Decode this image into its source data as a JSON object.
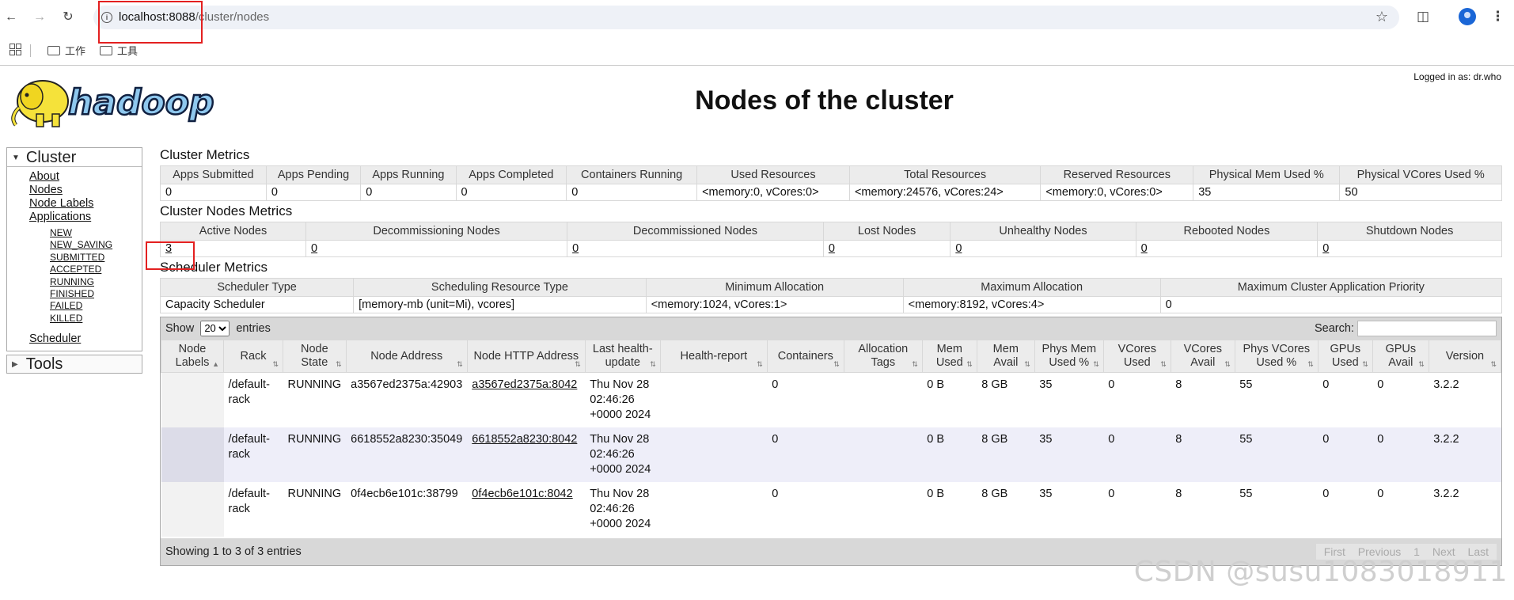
{
  "browser": {
    "url_host": "localhost:8088",
    "url_path": "/cluster/nodes",
    "bookmarks": [
      "工作",
      "工具"
    ]
  },
  "header": {
    "logged_in": "Logged in as: dr.who",
    "title": "Nodes of the cluster",
    "logo_text": "hadoop"
  },
  "sidebar": {
    "cluster_label": "Cluster",
    "links": [
      "About",
      "Nodes",
      "Node Labels",
      "Applications"
    ],
    "app_states": [
      "NEW",
      "NEW_SAVING",
      "SUBMITTED",
      "ACCEPTED",
      "RUNNING",
      "FINISHED",
      "FAILED",
      "KILLED"
    ],
    "scheduler": "Scheduler",
    "tools_label": "Tools"
  },
  "cluster_metrics": {
    "title": "Cluster Metrics",
    "headers": [
      "Apps Submitted",
      "Apps Pending",
      "Apps Running",
      "Apps Completed",
      "Containers Running",
      "Used Resources",
      "Total Resources",
      "Reserved Resources",
      "Physical Mem Used %",
      "Physical VCores Used %"
    ],
    "values": [
      "0",
      "0",
      "0",
      "0",
      "0",
      "<memory:0, vCores:0>",
      "<memory:24576, vCores:24>",
      "<memory:0, vCores:0>",
      "35",
      "50"
    ]
  },
  "node_metrics": {
    "title": "Cluster Nodes Metrics",
    "headers": [
      "Active Nodes",
      "Decommissioning Nodes",
      "Decommissioned Nodes",
      "Lost Nodes",
      "Unhealthy Nodes",
      "Rebooted Nodes",
      "Shutdown Nodes"
    ],
    "values": [
      "3",
      "0",
      "0",
      "0",
      "0",
      "0",
      "0"
    ]
  },
  "scheduler_metrics": {
    "title": "Scheduler Metrics",
    "headers": [
      "Scheduler Type",
      "Scheduling Resource Type",
      "Minimum Allocation",
      "Maximum Allocation",
      "Maximum Cluster Application Priority"
    ],
    "values": [
      "Capacity Scheduler",
      "[memory-mb (unit=Mi), vcores]",
      "<memory:1024, vCores:1>",
      "<memory:8192, vCores:4>",
      "0"
    ]
  },
  "nodes_table": {
    "show_label": "Show",
    "entries_label": "entries",
    "page_size": "20",
    "search_label": "Search:",
    "headers": [
      "Node Labels",
      "Rack",
      "Node State",
      "Node Address",
      "Node HTTP Address",
      "Last health-update",
      "Health-report",
      "Containers",
      "Allocation Tags",
      "Mem Used",
      "Mem Avail",
      "Phys Mem Used %",
      "VCores Used",
      "VCores Avail",
      "Phys VCores Used %",
      "GPUs Used",
      "GPUs Avail",
      "Version"
    ],
    "rows": [
      {
        "labels": "",
        "rack": "/default-rack",
        "state": "RUNNING",
        "address": "a3567ed2375a:42903",
        "http": "a3567ed2375a:8042",
        "health_update": "Thu Nov 28 02:46:26 +0000 2024",
        "health_report": "",
        "containers": "0",
        "tags": "",
        "mem_used": "0 B",
        "mem_avail": "8 GB",
        "phys_mem": "35",
        "vc_used": "0",
        "vc_avail": "8",
        "phys_vc": "55",
        "gpu_used": "0",
        "gpu_avail": "0",
        "version": "3.2.2"
      },
      {
        "labels": "",
        "rack": "/default-rack",
        "state": "RUNNING",
        "address": "6618552a8230:35049",
        "http": "6618552a8230:8042",
        "health_update": "Thu Nov 28 02:46:26 +0000 2024",
        "health_report": "",
        "containers": "0",
        "tags": "",
        "mem_used": "0 B",
        "mem_avail": "8 GB",
        "phys_mem": "35",
        "vc_used": "0",
        "vc_avail": "8",
        "phys_vc": "55",
        "gpu_used": "0",
        "gpu_avail": "0",
        "version": "3.2.2"
      },
      {
        "labels": "",
        "rack": "/default-rack",
        "state": "RUNNING",
        "address": "0f4ecb6e101c:38799",
        "http": "0f4ecb6e101c:8042",
        "health_update": "Thu Nov 28 02:46:26 +0000 2024",
        "health_report": "",
        "containers": "0",
        "tags": "",
        "mem_used": "0 B",
        "mem_avail": "8 GB",
        "phys_mem": "35",
        "vc_used": "0",
        "vc_avail": "8",
        "phys_vc": "55",
        "gpu_used": "0",
        "gpu_avail": "0",
        "version": "3.2.2"
      }
    ],
    "showing": "Showing 1 to 3 of 3 entries",
    "pager": [
      "First",
      "Previous",
      "1",
      "Next",
      "Last"
    ]
  },
  "watermark": "CSDN @susu1083018911"
}
